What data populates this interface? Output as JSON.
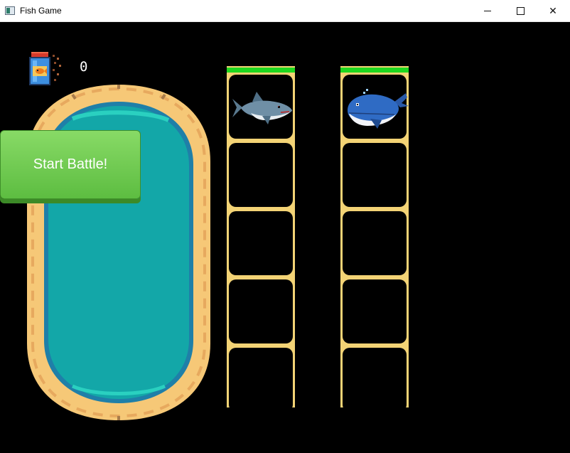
{
  "window": {
    "title": "Fish Game",
    "minimize_glyph": "",
    "maximize_glyph": "",
    "close_glyph": "✕"
  },
  "hud": {
    "fish_food_count": "0",
    "jar_icon": "fish-food-jar-icon"
  },
  "main": {
    "start_button_label": "Start Battle!"
  },
  "player_team": {
    "health_fraction": 1.0,
    "slots": [
      "shark",
      "",
      "",
      "",
      ""
    ]
  },
  "enemy_team": {
    "health_fraction": 1.0,
    "slots": [
      "whale",
      "",
      "",
      "",
      ""
    ]
  },
  "colors": {
    "background": "#000000",
    "tank_water": "#13a7a8",
    "tank_rim": "#f6c877",
    "button_green": "#6fca4d",
    "health_green": "#1fd81f",
    "slot_frame": "#f3d375"
  }
}
